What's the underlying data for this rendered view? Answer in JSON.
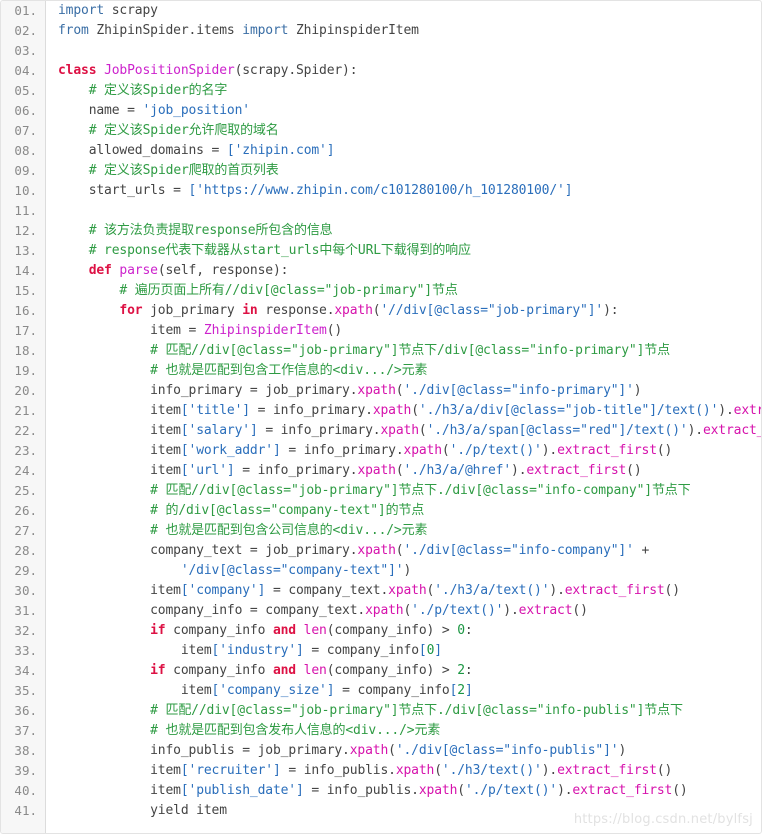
{
  "editor": {
    "language": "python",
    "line_count": 41,
    "first_line_number": 1,
    "line_number_suffix": ".",
    "gutter_color": "#f7f7f7",
    "background_color": "#ffffff",
    "border_color": "#e3e3e3"
  },
  "theme": {
    "plain": "#444444",
    "keyword": "#dd1144",
    "import": "#3a6ea5",
    "definition_name": "#cc22cc",
    "function": "#d612ac",
    "string": "#2a6ebb",
    "comment": "#2e9b43",
    "number": "#1a9642",
    "line_number": "#8a8a8a"
  },
  "watermark": {
    "text": "https://blog.csdn.net/bylfsj",
    "color": "#e2e2e2"
  },
  "lines": [
    {
      "n": "01.",
      "tokens": [
        {
          "t": "import",
          "c": "imp"
        },
        {
          "t": " scrapy",
          "c": "plain"
        }
      ]
    },
    {
      "n": "02.",
      "tokens": [
        {
          "t": "from",
          "c": "imp"
        },
        {
          "t": " ZhipinSpider.items ",
          "c": "plain"
        },
        {
          "t": "import",
          "c": "imp"
        },
        {
          "t": " ZhipinspiderItem",
          "c": "plain"
        }
      ]
    },
    {
      "n": "03.",
      "tokens": []
    },
    {
      "n": "04.",
      "tokens": [
        {
          "t": "class ",
          "c": "kw"
        },
        {
          "t": "JobPositionSpider",
          "c": "name"
        },
        {
          "t": "(scrapy.Spider):",
          "c": "plain"
        }
      ]
    },
    {
      "n": "05.",
      "tokens": [
        {
          "t": "    # 定义该Spider的名字",
          "c": "com"
        }
      ]
    },
    {
      "n": "06.",
      "tokens": [
        {
          "t": "    name ",
          "c": "plain"
        },
        {
          "t": "=",
          "c": "op"
        },
        {
          "t": " ",
          "c": "plain"
        },
        {
          "t": "'job_position'",
          "c": "str"
        }
      ]
    },
    {
      "n": "07.",
      "tokens": [
        {
          "t": "    # 定义该Spider允许爬取的域名",
          "c": "com"
        }
      ]
    },
    {
      "n": "08.",
      "tokens": [
        {
          "t": "    allowed_domains ",
          "c": "plain"
        },
        {
          "t": "=",
          "c": "op"
        },
        {
          "t": " ",
          "c": "plain"
        },
        {
          "t": "['zhipin.com']",
          "c": "str"
        }
      ]
    },
    {
      "n": "09.",
      "tokens": [
        {
          "t": "    # 定义该Spider爬取的首页列表",
          "c": "com"
        }
      ]
    },
    {
      "n": "10.",
      "tokens": [
        {
          "t": "    start_urls ",
          "c": "plain"
        },
        {
          "t": "=",
          "c": "op"
        },
        {
          "t": " ",
          "c": "plain"
        },
        {
          "t": "['https://www.zhipin.com/c101280100/h_101280100/']",
          "c": "str"
        }
      ]
    },
    {
      "n": "11.",
      "tokens": []
    },
    {
      "n": "12.",
      "tokens": [
        {
          "t": "    # 该方法负责提取response所包含的信息",
          "c": "com"
        }
      ]
    },
    {
      "n": "13.",
      "tokens": [
        {
          "t": "    # response代表下载器从start_urls中每个URL下载得到的响应",
          "c": "com"
        }
      ]
    },
    {
      "n": "14.",
      "tokens": [
        {
          "t": "    def ",
          "c": "kw"
        },
        {
          "t": "parse",
          "c": "name"
        },
        {
          "t": "(self, response):",
          "c": "plain"
        }
      ]
    },
    {
      "n": "15.",
      "tokens": [
        {
          "t": "        # 遍历页面上所有//div[@class=\"job-primary\"]节点",
          "c": "com"
        }
      ]
    },
    {
      "n": "16.",
      "tokens": [
        {
          "t": "        for ",
          "c": "kw"
        },
        {
          "t": "job_primary ",
          "c": "plain"
        },
        {
          "t": "in ",
          "c": "kw"
        },
        {
          "t": "response.",
          "c": "plain"
        },
        {
          "t": "xpath",
          "c": "fn"
        },
        {
          "t": "(",
          "c": "plain"
        },
        {
          "t": "'//div[@class=\"job-primary\"]'",
          "c": "str"
        },
        {
          "t": "):",
          "c": "plain"
        }
      ]
    },
    {
      "n": "17.",
      "tokens": [
        {
          "t": "            item ",
          "c": "plain"
        },
        {
          "t": "=",
          "c": "op"
        },
        {
          "t": " ",
          "c": "plain"
        },
        {
          "t": "ZhipinspiderItem",
          "c": "name"
        },
        {
          "t": "()",
          "c": "plain"
        }
      ]
    },
    {
      "n": "18.",
      "tokens": [
        {
          "t": "            # 匹配//div[@class=\"job-primary\"]节点下/div[@class=\"info-primary\"]节点",
          "c": "com"
        }
      ]
    },
    {
      "n": "19.",
      "tokens": [
        {
          "t": "            # 也就是匹配到包含工作信息的<div.../>元素",
          "c": "com"
        }
      ]
    },
    {
      "n": "20.",
      "tokens": [
        {
          "t": "            info_primary ",
          "c": "plain"
        },
        {
          "t": "=",
          "c": "op"
        },
        {
          "t": " job_primary.",
          "c": "plain"
        },
        {
          "t": "xpath",
          "c": "fn"
        },
        {
          "t": "(",
          "c": "plain"
        },
        {
          "t": "'./div[@class=\"info-primary\"]'",
          "c": "str"
        },
        {
          "t": ")",
          "c": "plain"
        }
      ]
    },
    {
      "n": "21.",
      "tokens": [
        {
          "t": "            item",
          "c": "plain"
        },
        {
          "t": "[",
          "c": "str"
        },
        {
          "t": "'title'",
          "c": "str"
        },
        {
          "t": "]",
          "c": "str"
        },
        {
          "t": " ",
          "c": "plain"
        },
        {
          "t": "=",
          "c": "op"
        },
        {
          "t": " info_primary.",
          "c": "plain"
        },
        {
          "t": "xpath",
          "c": "fn"
        },
        {
          "t": "(",
          "c": "plain"
        },
        {
          "t": "'./h3/a/div[@class=\"job-title\"]/text()'",
          "c": "str"
        },
        {
          "t": ").",
          "c": "plain"
        },
        {
          "t": "extract_firs",
          "c": "fn"
        }
      ]
    },
    {
      "n": "22.",
      "tokens": [
        {
          "t": "            item",
          "c": "plain"
        },
        {
          "t": "[",
          "c": "str"
        },
        {
          "t": "'salary'",
          "c": "str"
        },
        {
          "t": "]",
          "c": "str"
        },
        {
          "t": " ",
          "c": "plain"
        },
        {
          "t": "=",
          "c": "op"
        },
        {
          "t": " info_primary.",
          "c": "plain"
        },
        {
          "t": "xpath",
          "c": "fn"
        },
        {
          "t": "(",
          "c": "plain"
        },
        {
          "t": "'./h3/a/span[@class=\"red\"]/text()'",
          "c": "str"
        },
        {
          "t": ").",
          "c": "plain"
        },
        {
          "t": "extract_first",
          "c": "fn"
        },
        {
          "t": "()",
          "c": "plain"
        }
      ]
    },
    {
      "n": "23.",
      "tokens": [
        {
          "t": "            item",
          "c": "plain"
        },
        {
          "t": "[",
          "c": "str"
        },
        {
          "t": "'work_addr'",
          "c": "str"
        },
        {
          "t": "]",
          "c": "str"
        },
        {
          "t": " ",
          "c": "plain"
        },
        {
          "t": "=",
          "c": "op"
        },
        {
          "t": " info_primary.",
          "c": "plain"
        },
        {
          "t": "xpath",
          "c": "fn"
        },
        {
          "t": "(",
          "c": "plain"
        },
        {
          "t": "'./p/text()'",
          "c": "str"
        },
        {
          "t": ").",
          "c": "plain"
        },
        {
          "t": "extract_first",
          "c": "fn"
        },
        {
          "t": "()",
          "c": "plain"
        }
      ]
    },
    {
      "n": "24.",
      "tokens": [
        {
          "t": "            item",
          "c": "plain"
        },
        {
          "t": "[",
          "c": "str"
        },
        {
          "t": "'url'",
          "c": "str"
        },
        {
          "t": "]",
          "c": "str"
        },
        {
          "t": " ",
          "c": "plain"
        },
        {
          "t": "=",
          "c": "op"
        },
        {
          "t": " info_primary.",
          "c": "plain"
        },
        {
          "t": "xpath",
          "c": "fn"
        },
        {
          "t": "(",
          "c": "plain"
        },
        {
          "t": "'./h3/a/@href'",
          "c": "str"
        },
        {
          "t": ").",
          "c": "plain"
        },
        {
          "t": "extract_first",
          "c": "fn"
        },
        {
          "t": "()",
          "c": "plain"
        }
      ]
    },
    {
      "n": "25.",
      "tokens": [
        {
          "t": "            # 匹配//div[@class=\"job-primary\"]节点下./div[@class=\"info-company\"]节点下",
          "c": "com"
        }
      ]
    },
    {
      "n": "26.",
      "tokens": [
        {
          "t": "            # 的/div[@class=\"company-text\"]的节点",
          "c": "com"
        }
      ]
    },
    {
      "n": "27.",
      "tokens": [
        {
          "t": "            # 也就是匹配到包含公司信息的<div.../>元素",
          "c": "com"
        }
      ]
    },
    {
      "n": "28.",
      "tokens": [
        {
          "t": "            company_text ",
          "c": "plain"
        },
        {
          "t": "=",
          "c": "op"
        },
        {
          "t": " job_primary.",
          "c": "plain"
        },
        {
          "t": "xpath",
          "c": "fn"
        },
        {
          "t": "(",
          "c": "plain"
        },
        {
          "t": "'./div[@class=\"info-company\"]'",
          "c": "str"
        },
        {
          "t": " ",
          "c": "plain"
        },
        {
          "t": "+",
          "c": "op"
        }
      ]
    },
    {
      "n": "29.",
      "tokens": [
        {
          "t": "                ",
          "c": "plain"
        },
        {
          "t": "'/div[@class=\"company-text\"]'",
          "c": "str"
        },
        {
          "t": ")",
          "c": "plain"
        }
      ]
    },
    {
      "n": "30.",
      "tokens": [
        {
          "t": "            item",
          "c": "plain"
        },
        {
          "t": "[",
          "c": "str"
        },
        {
          "t": "'company'",
          "c": "str"
        },
        {
          "t": "]",
          "c": "str"
        },
        {
          "t": " ",
          "c": "plain"
        },
        {
          "t": "=",
          "c": "op"
        },
        {
          "t": " company_text.",
          "c": "plain"
        },
        {
          "t": "xpath",
          "c": "fn"
        },
        {
          "t": "(",
          "c": "plain"
        },
        {
          "t": "'./h3/a/text()'",
          "c": "str"
        },
        {
          "t": ").",
          "c": "plain"
        },
        {
          "t": "extract_first",
          "c": "fn"
        },
        {
          "t": "()",
          "c": "plain"
        }
      ]
    },
    {
      "n": "31.",
      "tokens": [
        {
          "t": "            company_info ",
          "c": "plain"
        },
        {
          "t": "=",
          "c": "op"
        },
        {
          "t": " company_text.",
          "c": "plain"
        },
        {
          "t": "xpath",
          "c": "fn"
        },
        {
          "t": "(",
          "c": "plain"
        },
        {
          "t": "'./p/text()'",
          "c": "str"
        },
        {
          "t": ").",
          "c": "plain"
        },
        {
          "t": "extract",
          "c": "fn"
        },
        {
          "t": "()",
          "c": "plain"
        }
      ]
    },
    {
      "n": "32.",
      "tokens": [
        {
          "t": "            if ",
          "c": "kw"
        },
        {
          "t": "company_info ",
          "c": "plain"
        },
        {
          "t": "and ",
          "c": "kw"
        },
        {
          "t": "len",
          "c": "fn"
        },
        {
          "t": "(company_info) ",
          "c": "plain"
        },
        {
          "t": ">",
          "c": "op"
        },
        {
          "t": " ",
          "c": "plain"
        },
        {
          "t": "0",
          "c": "num"
        },
        {
          "t": ":",
          "c": "plain"
        }
      ]
    },
    {
      "n": "33.",
      "tokens": [
        {
          "t": "                item",
          "c": "plain"
        },
        {
          "t": "[",
          "c": "str"
        },
        {
          "t": "'industry'",
          "c": "str"
        },
        {
          "t": "]",
          "c": "str"
        },
        {
          "t": " ",
          "c": "plain"
        },
        {
          "t": "=",
          "c": "op"
        },
        {
          "t": " company_info",
          "c": "plain"
        },
        {
          "t": "[",
          "c": "str"
        },
        {
          "t": "0",
          "c": "num"
        },
        {
          "t": "]",
          "c": "str"
        }
      ]
    },
    {
      "n": "34.",
      "tokens": [
        {
          "t": "            if ",
          "c": "kw"
        },
        {
          "t": "company_info ",
          "c": "plain"
        },
        {
          "t": "and ",
          "c": "kw"
        },
        {
          "t": "len",
          "c": "fn"
        },
        {
          "t": "(company_info) ",
          "c": "plain"
        },
        {
          "t": ">",
          "c": "op"
        },
        {
          "t": " ",
          "c": "plain"
        },
        {
          "t": "2",
          "c": "num"
        },
        {
          "t": ":",
          "c": "plain"
        }
      ]
    },
    {
      "n": "35.",
      "tokens": [
        {
          "t": "                item",
          "c": "plain"
        },
        {
          "t": "[",
          "c": "str"
        },
        {
          "t": "'company_size'",
          "c": "str"
        },
        {
          "t": "]",
          "c": "str"
        },
        {
          "t": " ",
          "c": "plain"
        },
        {
          "t": "=",
          "c": "op"
        },
        {
          "t": " company_info",
          "c": "plain"
        },
        {
          "t": "[",
          "c": "str"
        },
        {
          "t": "2",
          "c": "num"
        },
        {
          "t": "]",
          "c": "str"
        }
      ]
    },
    {
      "n": "36.",
      "tokens": [
        {
          "t": "            # 匹配//div[@class=\"job-primary\"]节点下./div[@class=\"info-publis\"]节点下",
          "c": "com"
        }
      ]
    },
    {
      "n": "37.",
      "tokens": [
        {
          "t": "            # 也就是匹配到包含发布人信息的<div.../>元素",
          "c": "com"
        }
      ]
    },
    {
      "n": "38.",
      "tokens": [
        {
          "t": "            info_publis ",
          "c": "plain"
        },
        {
          "t": "=",
          "c": "op"
        },
        {
          "t": " job_primary.",
          "c": "plain"
        },
        {
          "t": "xpath",
          "c": "fn"
        },
        {
          "t": "(",
          "c": "plain"
        },
        {
          "t": "'./div[@class=\"info-publis\"]'",
          "c": "str"
        },
        {
          "t": ")",
          "c": "plain"
        }
      ]
    },
    {
      "n": "39.",
      "tokens": [
        {
          "t": "            item",
          "c": "plain"
        },
        {
          "t": "[",
          "c": "str"
        },
        {
          "t": "'recruiter'",
          "c": "str"
        },
        {
          "t": "]",
          "c": "str"
        },
        {
          "t": " ",
          "c": "plain"
        },
        {
          "t": "=",
          "c": "op"
        },
        {
          "t": " info_publis.",
          "c": "plain"
        },
        {
          "t": "xpath",
          "c": "fn"
        },
        {
          "t": "(",
          "c": "plain"
        },
        {
          "t": "'./h3/text()'",
          "c": "str"
        },
        {
          "t": ").",
          "c": "plain"
        },
        {
          "t": "extract_first",
          "c": "fn"
        },
        {
          "t": "()",
          "c": "plain"
        }
      ]
    },
    {
      "n": "40.",
      "tokens": [
        {
          "t": "            item",
          "c": "plain"
        },
        {
          "t": "[",
          "c": "str"
        },
        {
          "t": "'publish_date'",
          "c": "str"
        },
        {
          "t": "]",
          "c": "str"
        },
        {
          "t": " ",
          "c": "plain"
        },
        {
          "t": "=",
          "c": "op"
        },
        {
          "t": " info_publis.",
          "c": "plain"
        },
        {
          "t": "xpath",
          "c": "fn"
        },
        {
          "t": "(",
          "c": "plain"
        },
        {
          "t": "'./p/text()'",
          "c": "str"
        },
        {
          "t": ").",
          "c": "plain"
        },
        {
          "t": "extract_first",
          "c": "fn"
        },
        {
          "t": "()",
          "c": "plain"
        }
      ]
    },
    {
      "n": "41.",
      "tokens": [
        {
          "t": "            yield item",
          "c": "plain"
        }
      ]
    }
  ]
}
